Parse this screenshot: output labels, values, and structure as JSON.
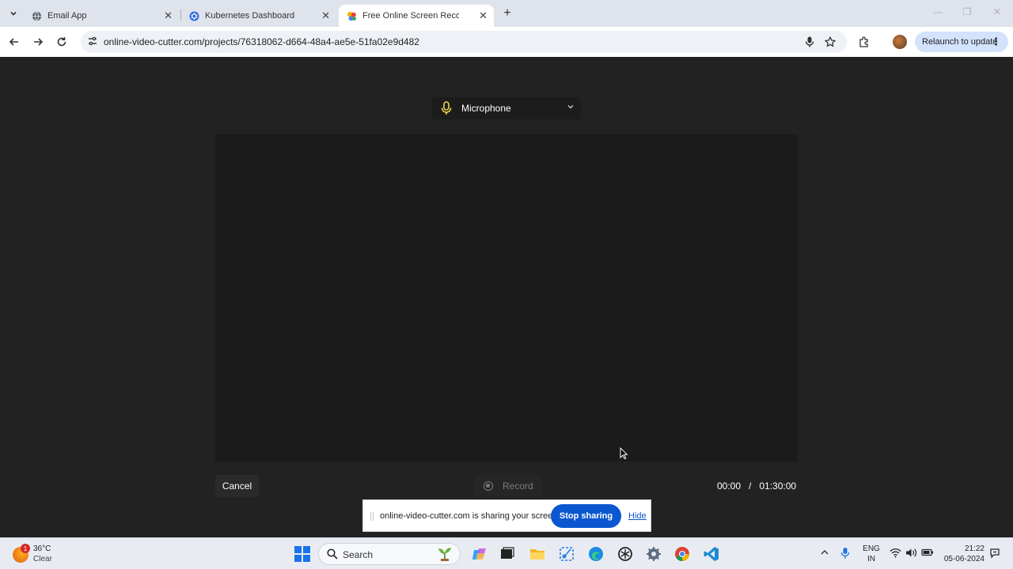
{
  "browser": {
    "tabs": [
      {
        "label": "Email App",
        "active": false
      },
      {
        "label": "Kubernetes Dashboard",
        "active": false
      },
      {
        "label": "Free Online Screen Recorder",
        "active": true
      }
    ],
    "url": "online-video-cutter.com/projects/76318062-d664-48a4-ae5e-51fa02e9d482",
    "relaunch_label": "Relaunch to update"
  },
  "recorder": {
    "audio_source": "Microphone",
    "cancel_label": "Cancel",
    "record_label": "Record",
    "elapsed": "00:00",
    "separator": "/",
    "max_duration": "01:30:00"
  },
  "share_bar": {
    "message": "online-video-cutter.com is sharing your screen.",
    "stop_label": "Stop sharing",
    "hide_label": "Hide"
  },
  "taskbar": {
    "weather_temp": "36°C",
    "weather_condition": "Clear",
    "weather_badge": "1",
    "search_placeholder": "Search",
    "lang_top": "ENG",
    "lang_bottom": "IN",
    "time": "21:22",
    "date": "05-06-2024"
  },
  "colors": {
    "page_bg": "#222222",
    "preview_bg": "#1b1b1b",
    "accent_blue": "#0b57d0",
    "mic_yellow": "#e8d44d"
  }
}
